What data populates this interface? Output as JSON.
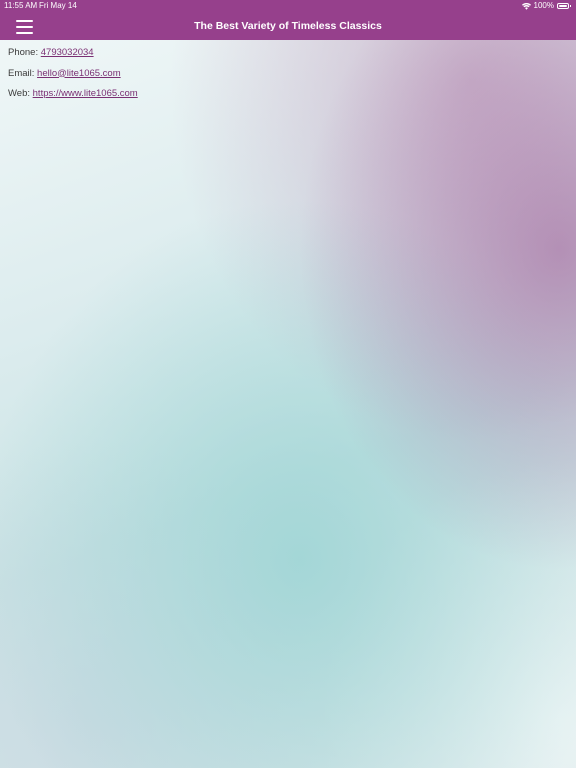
{
  "status_bar": {
    "time": "11:55 AM",
    "date": "Fri May 14",
    "battery": "100%"
  },
  "nav": {
    "title": "The Best Variety of Timeless Classics"
  },
  "contact": {
    "phone_label": "Phone:",
    "phone_value": "4793032034",
    "email_label": "Email:",
    "email_value": "hello@lite1065.com",
    "web_label": "Web:",
    "web_value": "https://www.lite1065.com"
  },
  "colors": {
    "header_background": "#96408c",
    "link": "#7a2f73",
    "text": "#3b3b3b"
  },
  "icons": {
    "menu": "hamburger-menu-icon",
    "wifi": "wifi-icon",
    "battery": "battery-icon"
  }
}
